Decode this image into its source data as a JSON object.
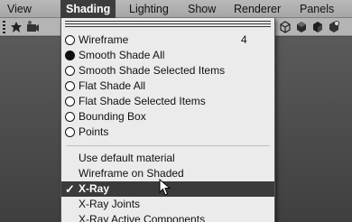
{
  "menubar": {
    "items": [
      "View",
      "Shading",
      "Lighting",
      "Show",
      "Renderer",
      "Panels"
    ],
    "active": "Shading"
  },
  "toolbar": {
    "left_icons": [
      "camera-icon",
      "camera-settings-icon"
    ],
    "right_icons": [
      "wireframe-cube-icon",
      "smooth-shade-icon",
      "textured-icon",
      "lit-icon"
    ]
  },
  "shading_menu": {
    "options": [
      {
        "label": "Wireframe",
        "hotkey": "4",
        "selected": false
      },
      {
        "label": "Smooth Shade All",
        "hotkey": "",
        "selected": true
      },
      {
        "label": "Smooth Shade Selected Items",
        "hotkey": "",
        "selected": false
      },
      {
        "label": "Flat Shade All",
        "hotkey": "",
        "selected": false
      },
      {
        "label": "Flat Shade Selected Items",
        "hotkey": "",
        "selected": false
      },
      {
        "label": "Bounding Box",
        "hotkey": "",
        "selected": false
      },
      {
        "label": "Points",
        "hotkey": "",
        "selected": false
      }
    ],
    "commands": [
      {
        "label": "Use default material",
        "checked": false,
        "highlighted": false
      },
      {
        "label": "Wireframe on Shaded",
        "checked": false,
        "highlighted": false
      },
      {
        "label": "X-Ray",
        "checked": true,
        "highlighted": true
      },
      {
        "label": "X-Ray Joints",
        "checked": false,
        "highlighted": false
      },
      {
        "label": "X-Ray Active Components",
        "checked": false,
        "highlighted": false
      }
    ],
    "check_glyph": "✓",
    "highlight_color": "#3b3b3b"
  }
}
